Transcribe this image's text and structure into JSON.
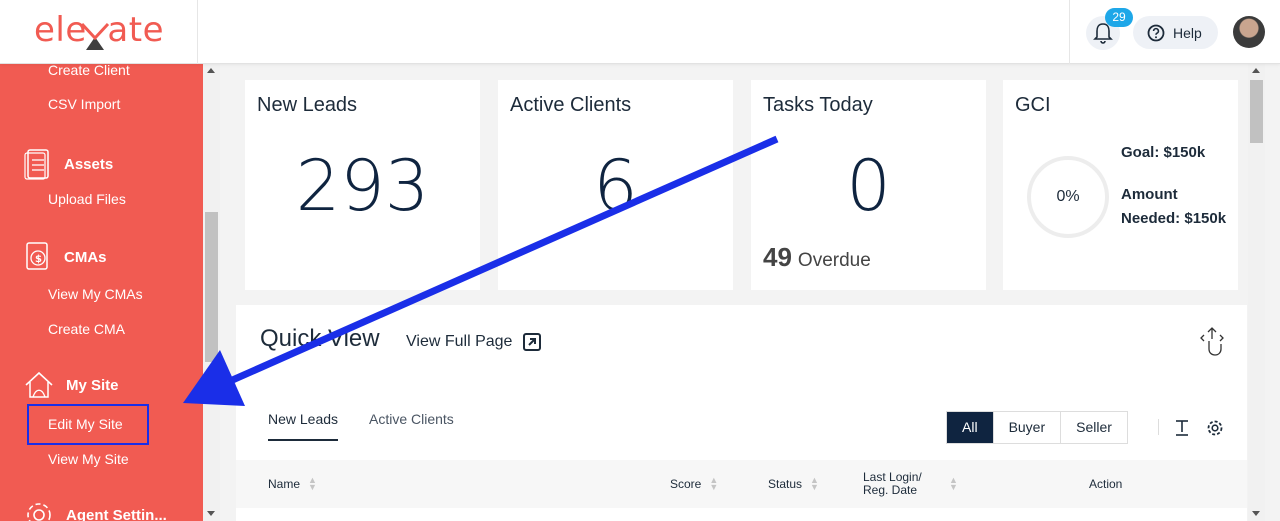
{
  "header": {
    "logo_text": "elevate",
    "notification_count": "29",
    "help_label": "Help"
  },
  "sidebar": {
    "items": [
      {
        "label": "Create Client",
        "type": "link"
      },
      {
        "label": "CSV Import",
        "type": "link"
      },
      {
        "label": "Assets",
        "type": "section",
        "icon": "document-icon"
      },
      {
        "label": "Upload Files",
        "type": "link"
      },
      {
        "label": "CMAs",
        "type": "section",
        "icon": "cma-icon"
      },
      {
        "label": "View My CMAs",
        "type": "link"
      },
      {
        "label": "Create CMA",
        "type": "link"
      },
      {
        "label": "My Site",
        "type": "section",
        "icon": "house-icon"
      },
      {
        "label": "Edit My Site",
        "type": "link"
      },
      {
        "label": "View My Site",
        "type": "link"
      },
      {
        "label": "Agent Settin...",
        "type": "section",
        "icon": "gear-icon"
      }
    ]
  },
  "cards": {
    "new_leads": {
      "title": "New Leads",
      "value": "293"
    },
    "active_clients": {
      "title": "Active Clients",
      "value": "6"
    },
    "tasks_today": {
      "title": "Tasks Today",
      "value": "0",
      "overdue_count": "49",
      "overdue_label": "Overdue"
    },
    "gci": {
      "title": "GCI",
      "percent": "0%",
      "goal": "Goal: $150k",
      "amount_needed": "Amount Needed: $150k"
    }
  },
  "quick_view": {
    "title": "Quick View",
    "full_page_link": "View Full Page",
    "tabs": [
      {
        "label": "New Leads",
        "active": true
      },
      {
        "label": "Active Clients",
        "active": false
      }
    ],
    "filters": [
      {
        "label": "All",
        "active": true
      },
      {
        "label": "Buyer",
        "active": false
      },
      {
        "label": "Seller",
        "active": false
      }
    ],
    "columns": [
      "Name",
      "Score",
      "Status",
      "Last Login/ Reg. Date",
      "Action"
    ]
  },
  "colors": {
    "brand": "#f15b52",
    "navy": "#0f2440",
    "badge": "#1ea7e8",
    "annotation": "#1a2ee8"
  }
}
